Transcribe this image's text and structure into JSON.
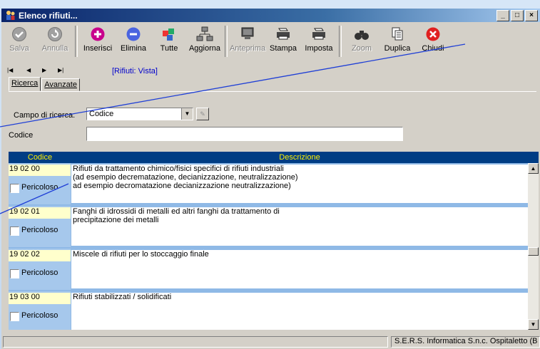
{
  "window": {
    "title": "Elenco rifiuti..."
  },
  "toolbar": {
    "buttons": [
      {
        "label": "Salva",
        "enabled": false
      },
      {
        "label": "Annulla",
        "enabled": false
      },
      {
        "label": "Inserisci",
        "enabled": true
      },
      {
        "label": "Elimina",
        "enabled": true
      },
      {
        "label": "Tutte",
        "enabled": true
      },
      {
        "label": "Aggiorna",
        "enabled": true
      },
      {
        "label": "Anteprima",
        "enabled": false
      },
      {
        "label": "Stampa",
        "enabled": true
      },
      {
        "label": "Imposta",
        "enabled": true
      },
      {
        "label": "Zoom",
        "enabled": false
      },
      {
        "label": "Duplica",
        "enabled": true
      },
      {
        "label": "Chiudi",
        "enabled": true
      }
    ]
  },
  "nav": {
    "view_label": "[Rifiuti: Vista]"
  },
  "tabs": [
    {
      "label": "Ricerca"
    },
    {
      "label": "Avanzate"
    }
  ],
  "search": {
    "campo_label": "Campo di ricerca:",
    "campo_value": "Codice",
    "codice_label": "Codice",
    "codice_value": ""
  },
  "grid": {
    "headers": {
      "code": "Codice",
      "desc": "Descrizione"
    },
    "rows": [
      {
        "code": "19 02 00",
        "desc": "Rifiuti da trattamento chimico/fisici specifici di rifiuti industriali\n(ad esempio decrematazione, decianizzazione, neutralizzazione)\nad esempio decromatazione decianizzazione neutralizzazione)",
        "pericoloso_label": "Pericoloso"
      },
      {
        "code": "19 02 01",
        "desc": "Fanghi di idrossidi di metalli ed altri fanghi da trattamento di\nprecipitazione dei metalli",
        "pericoloso_label": "Pericoloso"
      },
      {
        "code": "19 02 02",
        "desc": "Miscele di rifiuti per lo stoccaggio finale",
        "pericoloso_label": "Pericoloso"
      },
      {
        "code": "19 03 00",
        "desc": "Rifiuti stabilizzati / solidificati",
        "pericoloso_label": "Pericoloso"
      }
    ]
  },
  "status": {
    "right": "S.E.R.S. Informatica S.n.c. Ospitaletto (B"
  }
}
